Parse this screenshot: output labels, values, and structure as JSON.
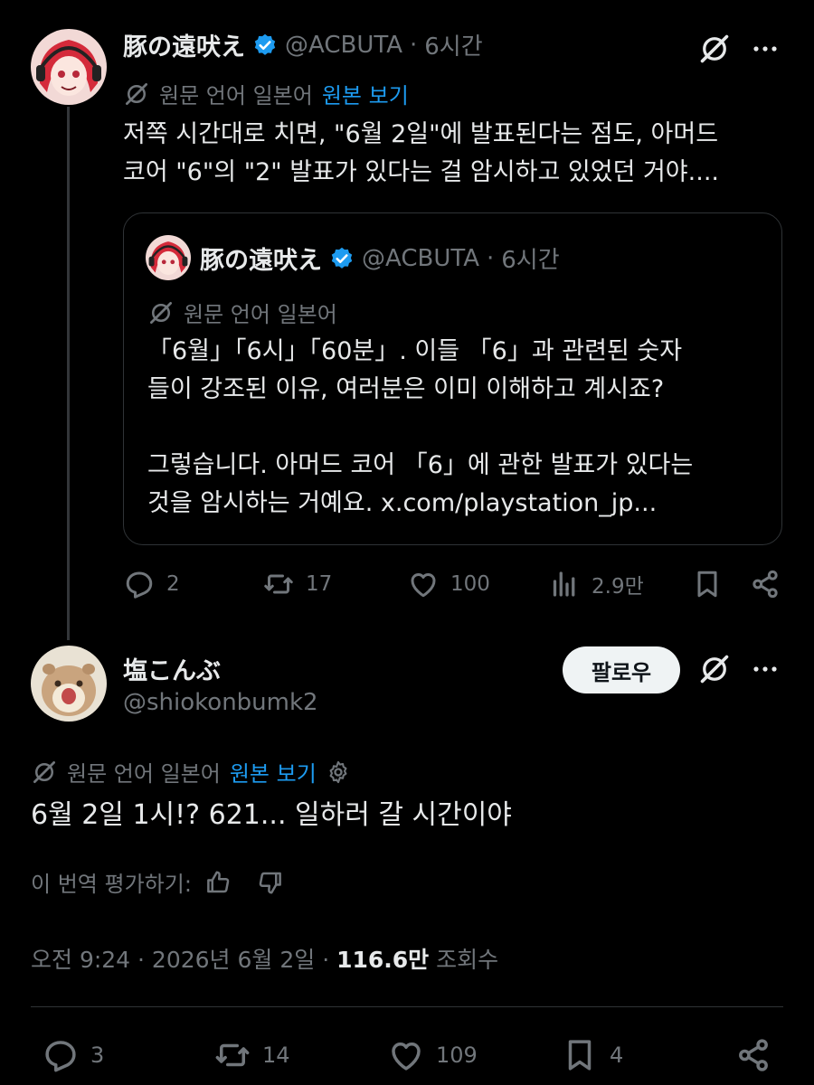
{
  "tweet1": {
    "name": "豚の遠吠え",
    "handle": "@ACBUTA",
    "time": "6시간",
    "translate": {
      "label": "원문 언어 일본어",
      "link": "원본 보기"
    },
    "text": "저쪽 시간대로 치면, \"6월 2일\"에 발표된다는 점도, 아머드\n코어 \"6\"의 \"2\" 발표가 있다는 걸 암시하고 있었던 거야....",
    "quote": {
      "name": "豚の遠吠え",
      "handle": "@ACBUTA",
      "time": "6시간",
      "translate_label": "원문 언어 일본어",
      "text": "「6월」「6시」「60분」. 이들 「6」과 관련된 숫자\n들이 강조된 이유, 여러분은 이미 이해하고 계시죠?\n\n그렇습니다. 아머드 코어 「6」에 관한 발표가 있다는\n것을 암시하는 거예요. x.com/playstation_jp..."
    },
    "stats": {
      "replies": "2",
      "reposts": "17",
      "likes": "100",
      "views": "2.9만"
    }
  },
  "tweet2": {
    "name": "塩こんぶ",
    "handle": "@shiokonbumk2",
    "follow_label": "팔로우",
    "translate": {
      "label": "원문 언어 일본어",
      "link": "원본 보기"
    },
    "text": "6월 2일 1시!? 621... 일하러 갈 시간이야",
    "rate_label": "이 번역 평가하기:",
    "meta": {
      "time": "오전 9:24 · 2026년 6월 2일 · ",
      "views": "116.6만",
      "views_label": " 조회수"
    },
    "stats": {
      "replies": "3",
      "reposts": "14",
      "likes": "109",
      "bookmarks": "4"
    }
  },
  "colors": {
    "background": "#000000",
    "text": "#e7e9ea",
    "muted": "#71767b",
    "link": "#1d9bf0",
    "verified": "#1d9bf0",
    "border": "#2f3336"
  },
  "icons": [
    "grok-icon",
    "more-icon",
    "verified-badge-icon",
    "translate-icon",
    "reply-icon",
    "repost-icon",
    "like-icon",
    "views-icon",
    "bookmark-icon",
    "share-icon",
    "settings-icon",
    "thumbs-up-icon",
    "thumbs-down-icon"
  ]
}
